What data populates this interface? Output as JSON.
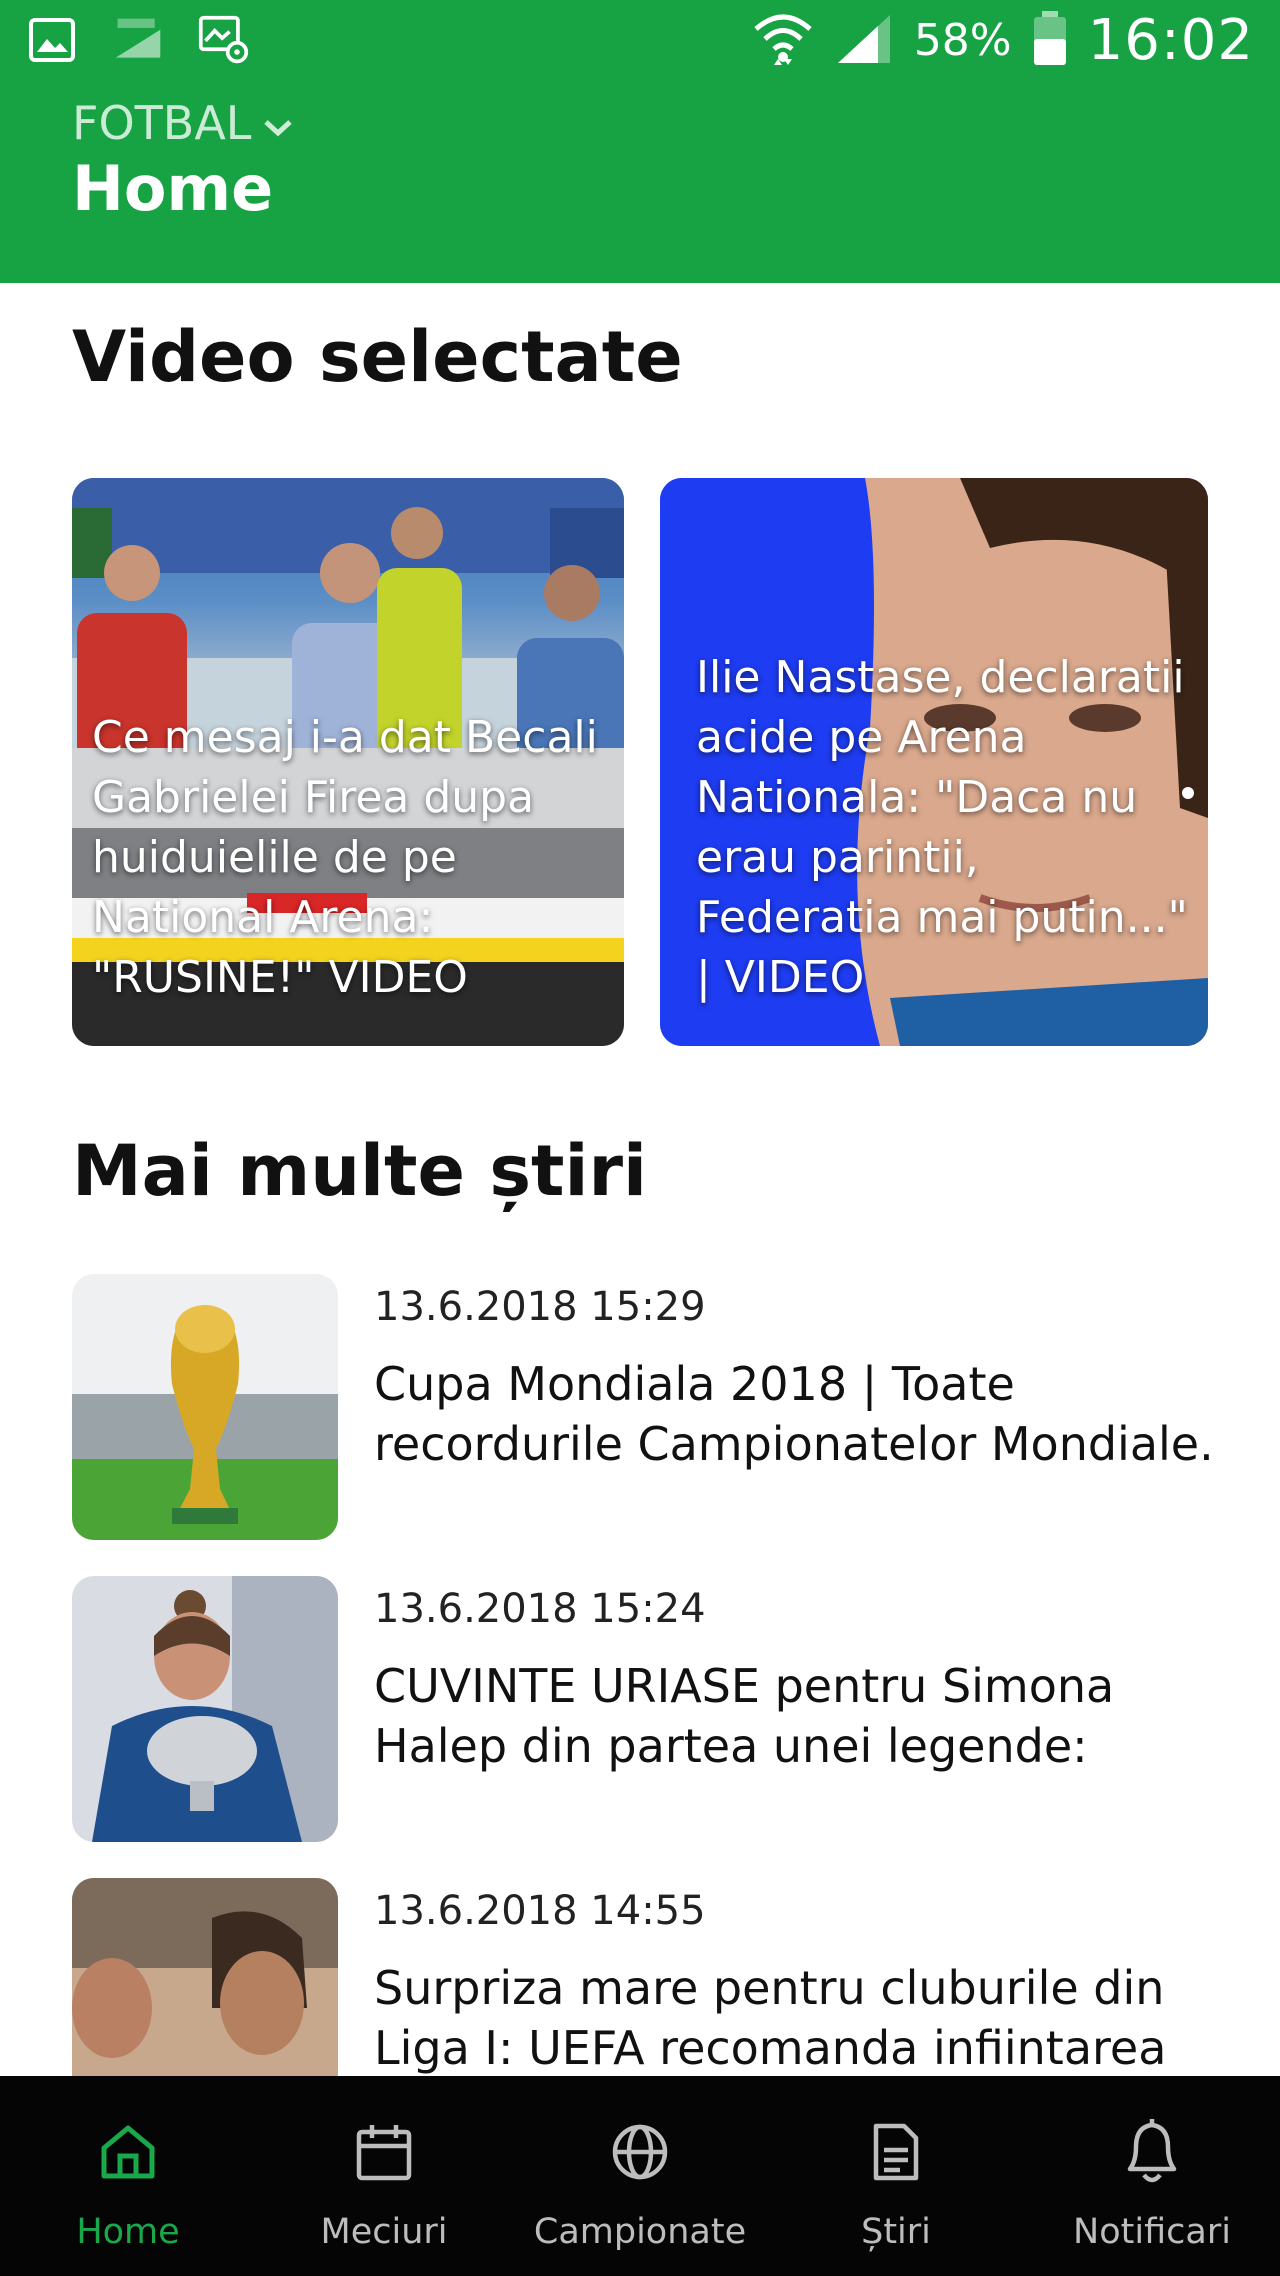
{
  "status_bar": {
    "battery": "58%",
    "time": "16:02",
    "icons": [
      "gallery-icon",
      "data-icon",
      "email-icon",
      "wifi-icon",
      "signal-icon",
      "battery-icon"
    ]
  },
  "header": {
    "section": "FOTBAL",
    "title": "Home"
  },
  "colors": {
    "brand": "#17a344",
    "nav_bg": "#050505",
    "nav_active": "#19a84a"
  },
  "videos": {
    "heading": "Video selectate",
    "items": [
      {
        "title": "Ce mesaj i-a dat Becali Gabrielei Firea dupa huiduielile de pe National Arena: \"RUSINE!\" VIDEO"
      },
      {
        "title": "Ilie Nastase, declaratii acide pe Arena Nationala: \"Daca nu erau parintii, Federatia mai putin...\" | VIDEO"
      }
    ]
  },
  "news": {
    "heading": "Mai multe știri",
    "items": [
      {
        "date": "13.6.2018 15:29",
        "title": "Cupa Mondiala 2018 | Toate recordurile Campionatelor Mondiale."
      },
      {
        "date": "13.6.2018 15:24",
        "title": "CUVINTE URIASE pentru Simona Halep din partea unei legende:"
      },
      {
        "date": "13.6.2018 14:55",
        "title": "Surpriza mare pentru cluburile din Liga I: UEFA recomanda infiintarea"
      }
    ]
  },
  "nav": {
    "items": [
      {
        "label": "Home",
        "icon": "home-icon",
        "active": true
      },
      {
        "label": "Meciuri",
        "icon": "calendar-icon"
      },
      {
        "label": "Campionate",
        "icon": "globe-icon"
      },
      {
        "label": "Știri",
        "icon": "document-icon"
      },
      {
        "label": "Notificari",
        "icon": "bell-icon"
      }
    ]
  }
}
